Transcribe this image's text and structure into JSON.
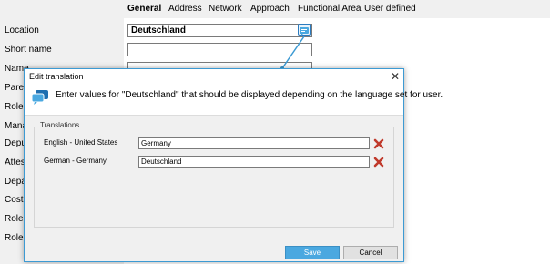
{
  "tabs": [
    "General",
    "Address",
    "Network",
    "Approach",
    "Functional Area",
    "User defined"
  ],
  "form": {
    "labels": [
      "Location",
      "Short name",
      "Name",
      "Parent",
      "Role",
      "Manager",
      "Deputy",
      "Attestation",
      "Department",
      "Cost center",
      "Role a",
      "Role a"
    ],
    "location_value": "Deutschland",
    "short_name_value": ""
  },
  "dialog": {
    "title": "Edit translation",
    "message": "Enter values for \"Deutschland\" that should be displayed depending on the language set for user.",
    "group_label": "Translations",
    "rows": [
      {
        "language": "English - United States",
        "value": "Germany"
      },
      {
        "language": "German - Germany",
        "value": "Deutschland"
      }
    ],
    "save_label": "Save",
    "cancel_label": "Cancel",
    "close_glyph": "✕"
  },
  "icons": {
    "translation": "translation-icon",
    "delete": "delete-x-icon",
    "dialog": "speech-bubble-icon"
  },
  "colors": {
    "accent": "#3c9ad3",
    "save_button": "#4aa8e0",
    "delete": "#c0392b"
  }
}
